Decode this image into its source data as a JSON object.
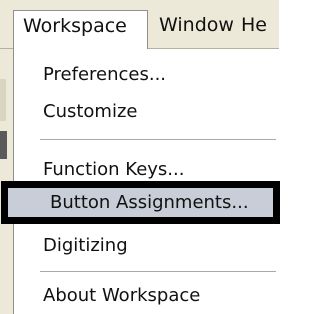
{
  "menubar": {
    "items": [
      {
        "label": "Workspace",
        "active": true
      },
      {
        "label": "Window",
        "active": false
      },
      {
        "label": "He",
        "active": false
      }
    ]
  },
  "dropdown": {
    "items": [
      {
        "label": "Preferences..."
      },
      {
        "label": "Customize"
      },
      {
        "label": "Function Keys..."
      },
      {
        "label": "Button Assignments...",
        "highlighted": true
      },
      {
        "label": "Digitizing"
      },
      {
        "label": "About Workspace"
      }
    ]
  },
  "colors": {
    "menubar_bg": "#ece9d8",
    "highlight_bg": "#c8cdd8",
    "highlight_border": "#000000"
  }
}
